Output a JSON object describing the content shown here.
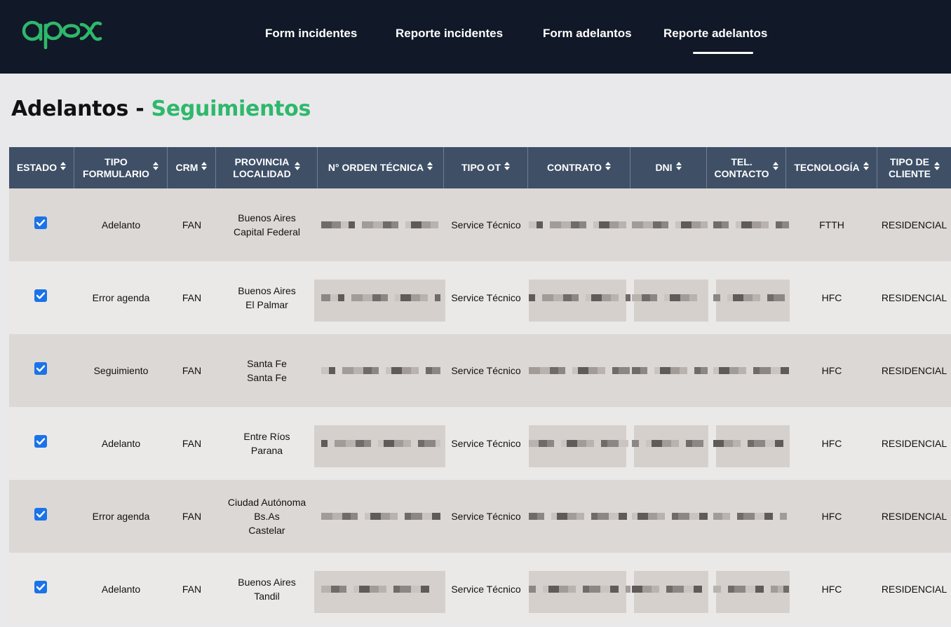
{
  "brand": {
    "logo_text": "apex",
    "accent_color": "#2eb86b",
    "navbar_color": "#111827"
  },
  "nav": {
    "links": [
      "Form incidentes",
      "Reporte incidentes",
      "Form adelantos",
      "Reporte adelantos"
    ],
    "active": "Reporte adelantos"
  },
  "page": {
    "title_main": "Adelantos",
    "title_sep": "-",
    "title_accent": "Seguimientos"
  },
  "table": {
    "header_color": "#3e4f66",
    "columns": [
      {
        "line1": "ESTADO",
        "line2": ""
      },
      {
        "line1": "TIPO",
        "line2": "FORMULARIO"
      },
      {
        "line1": "CRM",
        "line2": ""
      },
      {
        "line1": "PROVINCIA",
        "line2": "LOCALIDAD"
      },
      {
        "line1": "N° ORDEN TÉCNICA",
        "line2": ""
      },
      {
        "line1": "TIPO OT",
        "line2": ""
      },
      {
        "line1": "CONTRATO",
        "line2": ""
      },
      {
        "line1": "DNI",
        "line2": ""
      },
      {
        "line1": "TEL.",
        "line2": "CONTACTO"
      },
      {
        "line1": "TECNOLOGÍA",
        "line2": ""
      },
      {
        "line1": "TIPO DE",
        "line2": "CLIENTE"
      }
    ],
    "sort_icon": "sort-updown-icon",
    "rows": [
      {
        "estado_checked": true,
        "tipo_formulario": "Adelanto",
        "crm": "FAN",
        "provincia": "Buenos Aires",
        "localidad": "Capital Federal",
        "tipo_ot": "Service Técnico",
        "tecnologia": "FTTH",
        "tipo_cliente": "RESIDENCIAL"
      },
      {
        "estado_checked": true,
        "tipo_formulario": "Error agenda",
        "crm": "FAN",
        "provincia": "Buenos Aires",
        "localidad": "El Palmar",
        "tipo_ot": "Service Técnico",
        "tecnologia": "HFC",
        "tipo_cliente": "RESIDENCIAL"
      },
      {
        "estado_checked": true,
        "tipo_formulario": "Seguimiento",
        "crm": "FAN",
        "provincia": "Santa Fe",
        "localidad": "Santa Fe",
        "tipo_ot": "Service Técnico",
        "tecnologia": "HFC",
        "tipo_cliente": "RESIDENCIAL"
      },
      {
        "estado_checked": true,
        "tipo_formulario": "Adelanto",
        "crm": "FAN",
        "provincia": "Entre Ríos",
        "localidad": "Parana",
        "tipo_ot": "Service Técnico",
        "tecnologia": "HFC",
        "tipo_cliente": "RESIDENCIAL"
      },
      {
        "estado_checked": true,
        "tipo_formulario": "Error agenda",
        "crm": "FAN",
        "provincia": "Ciudad Autónoma Bs.As",
        "localidad": "Castelar",
        "tipo_ot": "Service Técnico",
        "tecnologia": "HFC",
        "tipo_cliente": "RESIDENCIAL"
      },
      {
        "estado_checked": true,
        "tipo_formulario": "Adelanto",
        "crm": "FAN",
        "provincia": "Buenos Aires",
        "localidad": "Tandil",
        "tipo_ot": "Service Técnico",
        "tecnologia": "HFC",
        "tipo_cliente": "RESIDENCIAL"
      }
    ],
    "redacted_fields": [
      "orden_tecnica",
      "contrato",
      "dni",
      "tel_contacto"
    ]
  }
}
